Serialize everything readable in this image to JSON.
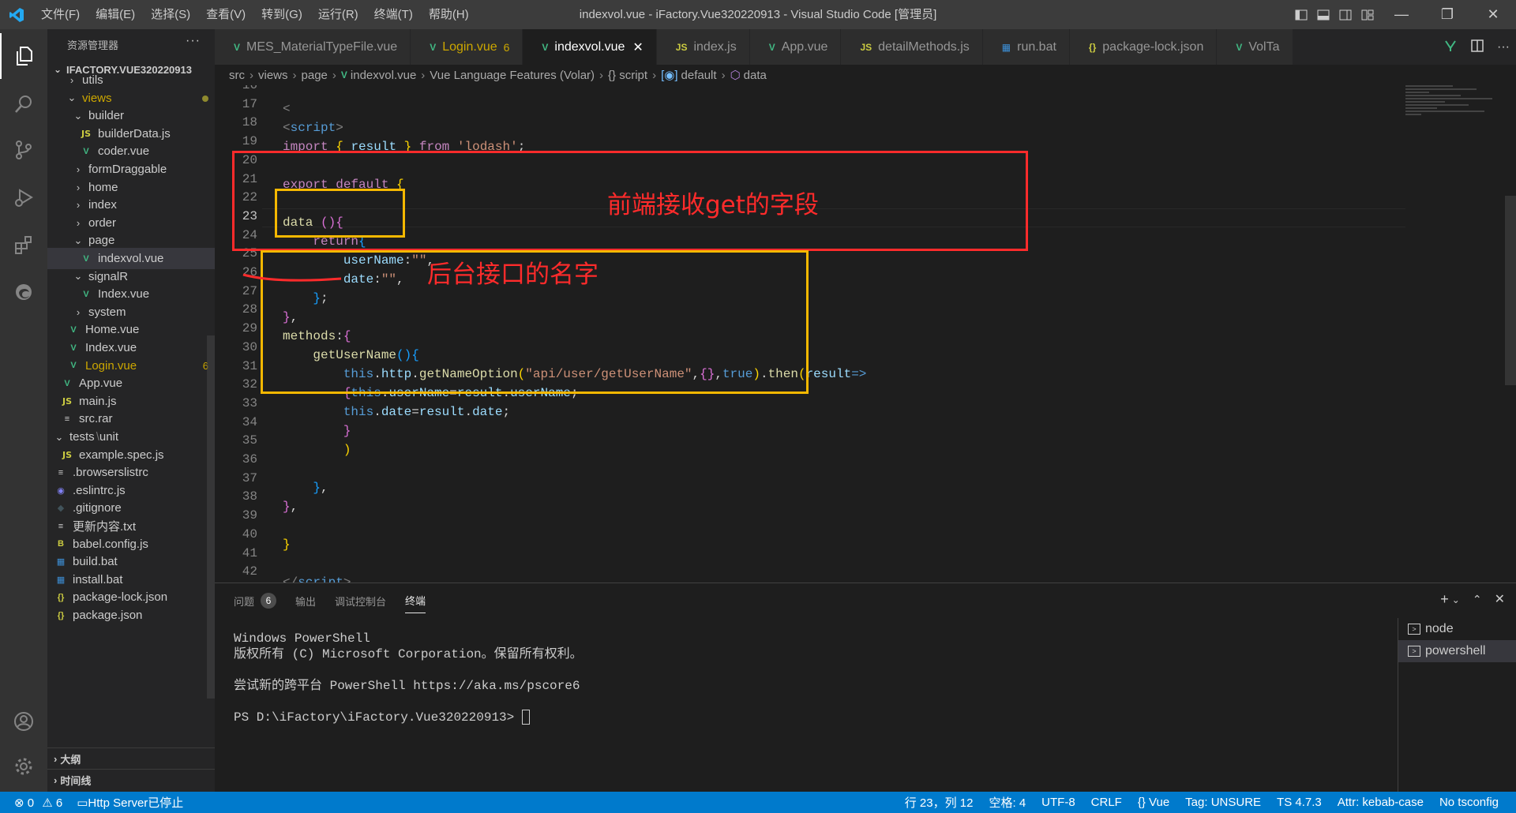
{
  "titlebar": {
    "menu": [
      "文件(F)",
      "编辑(E)",
      "选择(S)",
      "查看(V)",
      "转到(G)",
      "运行(R)",
      "终端(T)",
      "帮助(H)"
    ],
    "title": "indexvol.vue - iFactory.Vue320220913 - Visual Studio Code [管理员]"
  },
  "sidebar": {
    "header": "资源管理器",
    "more": "···",
    "project": "IFACTORY.VUE320220913",
    "items": [
      {
        "label": "utils",
        "type": "folder"
      },
      {
        "label": "views",
        "type": "folder-open"
      },
      {
        "label": "builder",
        "type": "folder-open"
      },
      {
        "label": "builderData.js",
        "type": "js"
      },
      {
        "label": "coder.vue",
        "type": "vue"
      },
      {
        "label": "formDraggable",
        "type": "folder"
      },
      {
        "label": "home",
        "type": "folder"
      },
      {
        "label": "index",
        "type": "folder"
      },
      {
        "label": "order",
        "type": "folder"
      },
      {
        "label": "page",
        "type": "folder-open"
      },
      {
        "label": "indexvol.vue",
        "type": "vue"
      },
      {
        "label": "signalR",
        "type": "folder-open"
      },
      {
        "label": "Index.vue",
        "type": "vue"
      },
      {
        "label": "system",
        "type": "folder"
      },
      {
        "label": "Home.vue",
        "type": "vue"
      },
      {
        "label": "Index.vue",
        "type": "vue"
      },
      {
        "label": "Login.vue",
        "type": "vue",
        "badge": "6"
      },
      {
        "label": "App.vue",
        "type": "vue"
      },
      {
        "label": "main.js",
        "type": "js"
      },
      {
        "label": "src.rar",
        "type": "file"
      },
      {
        "label": "tests",
        "type": "folder-open",
        "suffix": "unit"
      },
      {
        "label": "example.spec.js",
        "type": "js"
      },
      {
        "label": ".browserslistrc",
        "type": "file"
      },
      {
        "label": ".eslintrc.js",
        "type": "eslint"
      },
      {
        "label": ".gitignore",
        "type": "git"
      },
      {
        "label": "更新内容.txt",
        "type": "file"
      },
      {
        "label": "babel.config.js",
        "type": "babel"
      },
      {
        "label": "build.bat",
        "type": "bat"
      },
      {
        "label": "install.bat",
        "type": "bat"
      },
      {
        "label": "package-lock.json",
        "type": "json"
      },
      {
        "label": "package.json",
        "type": "json"
      }
    ],
    "sections": [
      "大纲",
      "时间线"
    ]
  },
  "tabs": [
    {
      "label": "MES_MaterialTypeFile.vue",
      "icon": "vue"
    },
    {
      "label": "Login.vue",
      "icon": "vue",
      "count": "6",
      "warn": true
    },
    {
      "label": "indexvol.vue",
      "icon": "vue",
      "active": true,
      "close": "✕"
    },
    {
      "label": "index.js",
      "icon": "js"
    },
    {
      "label": "App.vue",
      "icon": "vue"
    },
    {
      "label": "detailMethods.js",
      "icon": "js"
    },
    {
      "label": "run.bat",
      "icon": "bat"
    },
    {
      "label": "package-lock.json",
      "icon": "json"
    },
    {
      "label": "VolTa",
      "icon": "vue"
    }
  ],
  "breadcrumb": [
    "src",
    "views",
    "page",
    "indexvol.vue",
    "Vue Language Features (Volar)",
    "{} script",
    "default",
    "data"
  ],
  "editor": {
    "current_line": "23",
    "line_numbers": [
      "16",
      "17",
      "18",
      "19",
      "20",
      "21",
      "22",
      "23",
      "24",
      "25",
      "26",
      "27",
      "28",
      "29",
      "30",
      "31",
      "32",
      "33",
      "34",
      "35",
      "36",
      "37",
      "38",
      "39",
      "40",
      "41",
      "42"
    ],
    "annotations": {
      "frontend_fields": "前端接收get的字段",
      "backend_api_name": "后台接口的名字"
    }
  },
  "panel": {
    "tabs": [
      {
        "label": "问题",
        "badge": "6"
      },
      {
        "label": "输出"
      },
      {
        "label": "调试控制台"
      },
      {
        "label": "终端",
        "active": true
      }
    ],
    "terminal_lines": [
      "Windows PowerShell",
      "版权所有 (C) Microsoft Corporation。保留所有权利。",
      "",
      "尝试新的跨平台 PowerShell https://aka.ms/pscore6",
      "",
      "PS D:\\iFactory\\iFactory.Vue320220913> "
    ],
    "terminals": [
      "node",
      "powershell"
    ]
  },
  "statusbar": {
    "errors": "0",
    "warnings": "6",
    "http": "Http Server已停止",
    "position": "行 23，列 12",
    "spaces": "空格: 4",
    "encoding": "UTF-8",
    "eol": "CRLF",
    "language": "Vue",
    "tag": "Tag: UNSURE",
    "ts": "TS 4.7.3",
    "attr": "Attr: kebab-case",
    "tsconfig": "No tsconfig"
  },
  "colors": {
    "accent": "#007acc",
    "annotation_red": "#ff2b2b",
    "annotation_yellow": "#f5b800"
  }
}
